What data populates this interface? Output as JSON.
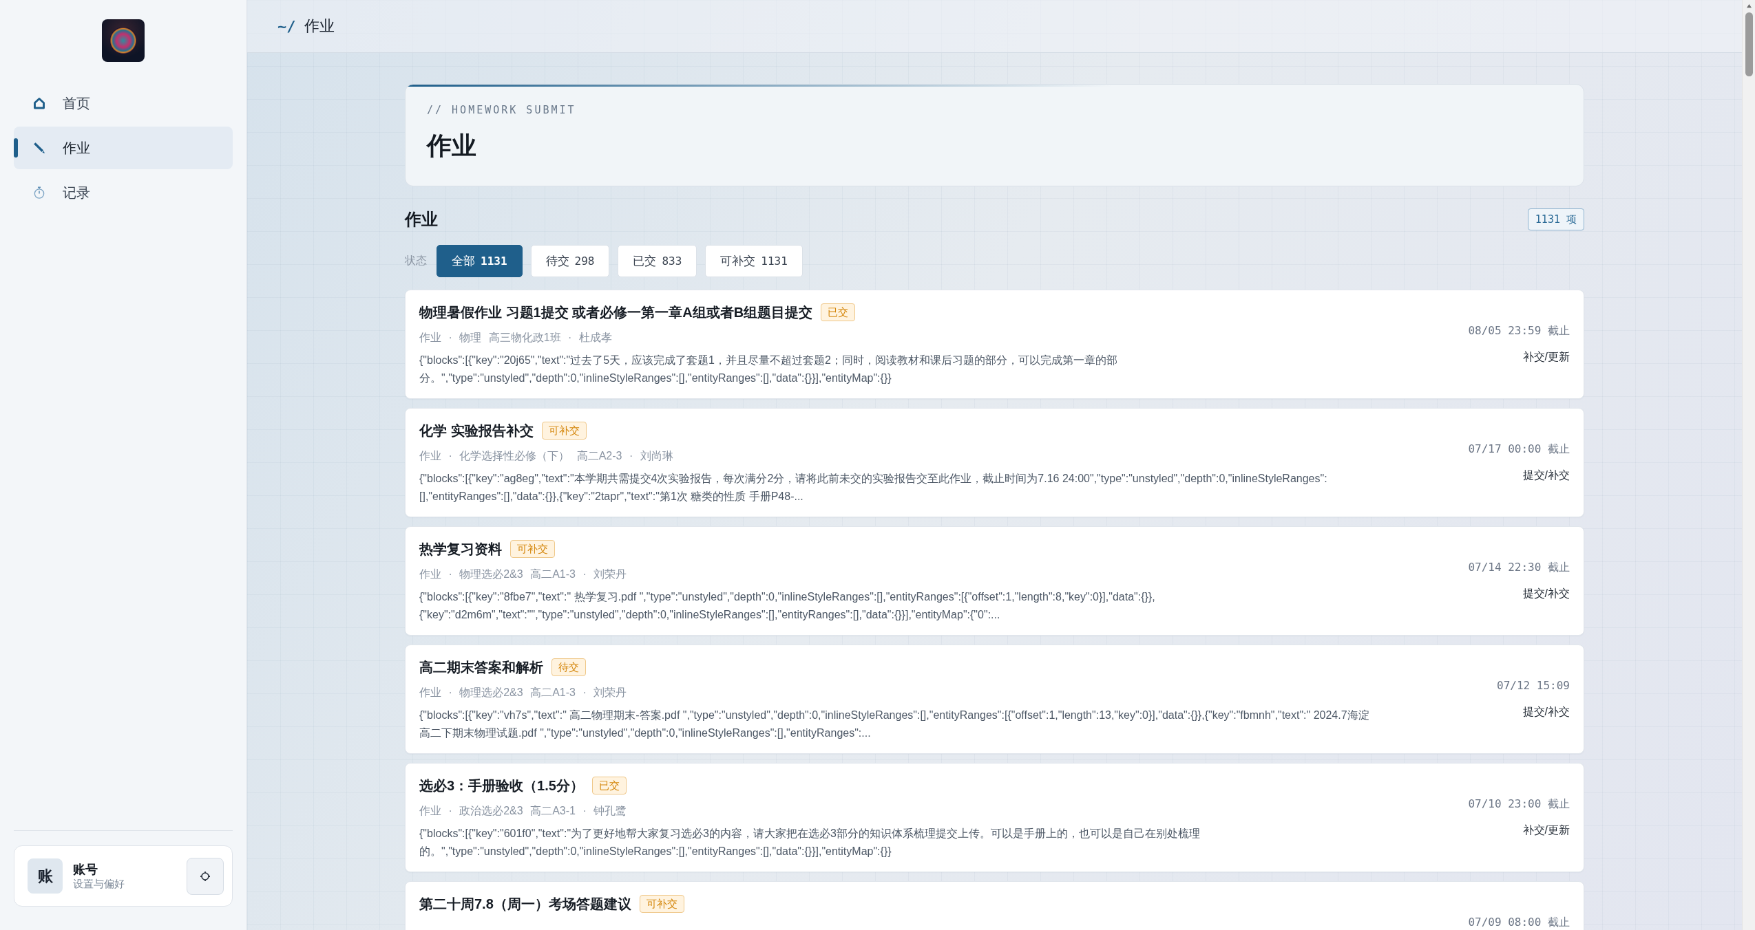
{
  "sidebar": {
    "nav": [
      {
        "kind": "home",
        "label": "首页",
        "selected": false
      },
      {
        "kind": "edit",
        "label": "作业",
        "selected": true
      },
      {
        "kind": "timer",
        "label": "记录",
        "selected": false
      }
    ],
    "account": {
      "avatar": "账",
      "name": "账号",
      "subtitle": "设置与偏好"
    }
  },
  "header": {
    "prefix": "~/",
    "title": "作业"
  },
  "hero": {
    "eyebrow": "// HOMEWORK SUBMIT",
    "title": "作业"
  },
  "section": {
    "title": "作业",
    "count": "1131 项"
  },
  "filters": {
    "label": "状态",
    "options": [
      {
        "label": "全部",
        "count": "1131",
        "selected": true
      },
      {
        "label": "待交",
        "count": "298",
        "selected": false
      },
      {
        "label": "已交",
        "count": "833",
        "selected": false
      },
      {
        "label": "可补交",
        "count": "1131",
        "selected": false
      }
    ]
  },
  "assignments": [
    {
      "title": "物理暑假作业 习题1提交 或者必修一第一章A组或者B组题目提交",
      "status": "已交",
      "meta": "作业 · 物理 高三物化政1班 · 杜成孝",
      "body": "{\"blocks\":[{\"key\":\"20j65\",\"text\":\"过去了5天，应该完成了套题1，并且尽量不超过套题2；同时，阅读教材和课后习题的部分，可以完成第一章的部分。\",\"type\":\"unstyled\",\"depth\":0,\"inlineStyleRanges\":[],\"entityRanges\":[],\"data\":{}}],\"entityMap\":{}}",
      "deadline": "08/05 23:59 截止",
      "action": "补交/更新"
    },
    {
      "title": "化学 实验报告补交",
      "status": "可补交",
      "meta": "作业 · 化学选择性必修（下） 高二A2-3 · 刘尚琳",
      "body": "{\"blocks\":[{\"key\":\"ag8eg\",\"text\":\"本学期共需提交4次实验报告，每次满分2分，请将此前未交的实验报告交至此作业，截止时间为7.16 24:00\",\"type\":\"unstyled\",\"depth\":0,\"inlineStyleRanges\":[],\"entityRanges\":[],\"data\":{}},{\"key\":\"2tapr\",\"text\":\"第1次 糖类的性质 手册P48-...",
      "deadline": "07/17 00:00 截止",
      "action": "提交/补交"
    },
    {
      "title": "热学复习资料",
      "status": "可补交",
      "meta": "作业 · 物理选必2&3 高二A1-3 · 刘荣丹",
      "body": "{\"blocks\":[{\"key\":\"8fbe7\",\"text\":\" 热学复习.pdf \",\"type\":\"unstyled\",\"depth\":0,\"inlineStyleRanges\":[],\"entityRanges\":[{\"offset\":1,\"length\":8,\"key\":0}],\"data\":{}},{\"key\":\"d2m6m\",\"text\":\"\",\"type\":\"unstyled\",\"depth\":0,\"inlineStyleRanges\":[],\"entityRanges\":[],\"data\":{}}],\"entityMap\":{\"0\":...",
      "deadline": "07/14 22:30 截止",
      "action": "提交/补交"
    },
    {
      "title": "高二期末答案和解析",
      "status": "待交",
      "meta": "作业 · 物理选必2&3 高二A1-3 · 刘荣丹",
      "body": "{\"blocks\":[{\"key\":\"vh7s\",\"text\":\" 高二物理期末-答案.pdf \",\"type\":\"unstyled\",\"depth\":0,\"inlineStyleRanges\":[],\"entityRanges\":[{\"offset\":1,\"length\":13,\"key\":0}],\"data\":{}},{\"key\":\"fbmnh\",\"text\":\" 2024.7海淀高二下期末物理试题.pdf \",\"type\":\"unstyled\",\"depth\":0,\"inlineStyleRanges\":[],\"entityRanges\":...",
      "deadline": "07/12 15:09",
      "action": "提交/补交"
    },
    {
      "title": "选必3：手册验收（1.5分）",
      "status": "已交",
      "meta": "作业 · 政治选必2&3 高二A3-1 · 钟孔鹭",
      "body": "{\"blocks\":[{\"key\":\"601f0\",\"text\":\"为了更好地帮大家复习选必3的内容，请大家把在选必3部分的知识体系梳理提交上传。可以是手册上的，也可以是自己在别处梳理的。\",\"type\":\"unstyled\",\"depth\":0,\"inlineStyleRanges\":[],\"entityRanges\":[],\"data\":{}}],\"entityMap\":{}}",
      "deadline": "07/10 23:00 截止",
      "action": "补交/更新"
    },
    {
      "title": "第二十周7.8（周一）考场答题建议",
      "status": "可补交",
      "deadline": "07/09 08:00 截止"
    }
  ]
}
